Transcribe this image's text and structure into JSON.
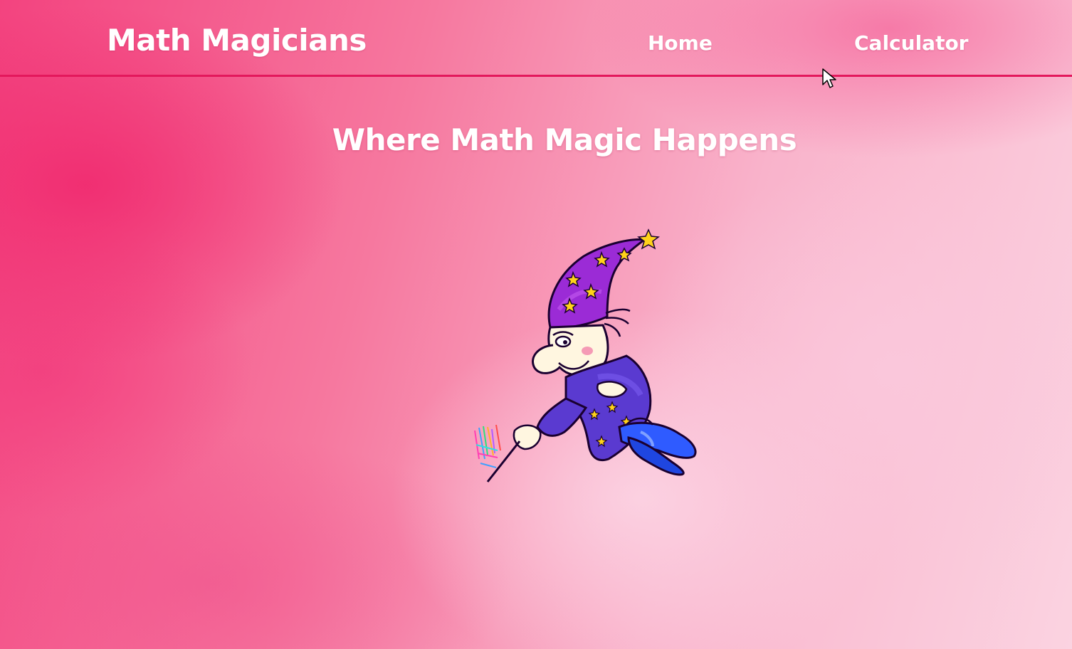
{
  "navbar": {
    "brand": "Math Magicians",
    "links": [
      {
        "label": "Home"
      },
      {
        "label": "Calculator"
      }
    ]
  },
  "main": {
    "headline": "Where Math Magic Happens",
    "illustration": "flying-wizard-illustration"
  },
  "colors": {
    "accent_line": "#e3185c",
    "background_primary": "#f3437f",
    "background_light": "#fbd3e1",
    "text": "#ffffff"
  },
  "icons": {
    "cursor": "mouse-pointer-icon"
  }
}
